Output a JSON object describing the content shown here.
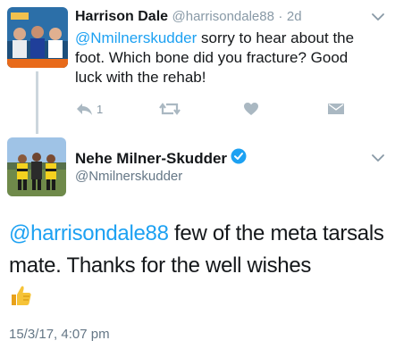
{
  "reply_tweet": {
    "display_name": "Harrison Dale",
    "handle": "@harrisondale88",
    "time_sep": "·",
    "time": "2d",
    "mention": "@Nmilnerskudder",
    "body": " sorry to hear about the foot. Which bone did you fracture? Good luck with the rehab!",
    "reply_count": "1",
    "icons": [
      "reply-icon",
      "retweet-icon",
      "like-icon",
      "direct-message-icon",
      "chevron-down-icon"
    ]
  },
  "main_tweet": {
    "display_name": "Nehe Milner-Skudder",
    "verified": true,
    "handle": "@Nmilnerskudder",
    "mention": "@harrisondale88",
    "body": " few of the meta tarsals mate. Thanks for the well wishes",
    "emoji": "thumbs-up",
    "timestamp": "15/3/17, 4:07 pm"
  },
  "colors": {
    "link": "#1da1f2",
    "meta": "#8899a6",
    "text": "#14171a",
    "thread_line": "#ccd6dd",
    "verified": "#1da1f2"
  }
}
